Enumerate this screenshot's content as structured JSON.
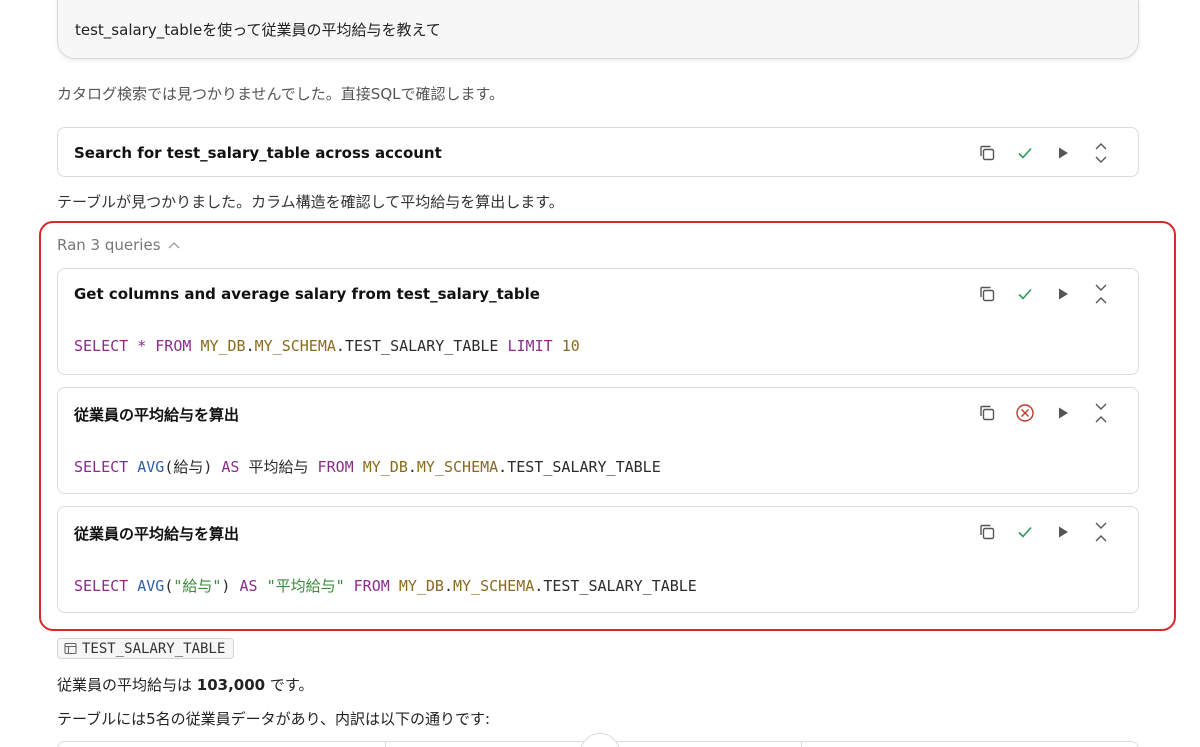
{
  "prompt": {
    "text": "test_salary_tableを使って従業員の平均給与を教えて"
  },
  "messages": {
    "catalog_note": "カタログ検索では見つかりませんでした。直接SQLで確認します。",
    "found_note": "テーブルが見つかりました。カラム構造を確認して平均給与を算出します。",
    "result_prefix": "従業員の平均給与は ",
    "result_value": "103,000",
    "result_suffix": " です。",
    "breakdown_note": "テーブルには5名の従業員データがあり、内訳は以下の通りです:"
  },
  "search_card": {
    "title": "Search for test_salary_table across account"
  },
  "query_group": {
    "label": "Ran 3 queries"
  },
  "queries": [
    {
      "title": "Get columns and average salary from test_salary_table",
      "status": "success",
      "code": {
        "kw1": "SELECT",
        "op": " * ",
        "kw2": "FROM",
        "db": "MY_DB",
        "dot1": ".",
        "schema": "MY_SCHEMA",
        "dot2": ".",
        "table": "TEST_SALARY_TABLE",
        "kw3": "LIMIT",
        "num": "10"
      }
    },
    {
      "title": "従業員の平均給与を算出",
      "status": "error",
      "code": {
        "kw1": "SELECT",
        "fn": "AVG",
        "args": "(給与)",
        "kw2": "AS",
        "alias": "平均給与",
        "kw3": "FROM",
        "db": "MY_DB",
        "dot1": ".",
        "schema": "MY_SCHEMA",
        "dot2": ".",
        "table": "TEST_SALARY_TABLE"
      }
    },
    {
      "title": "従業員の平均給与を算出",
      "status": "success",
      "code": {
        "kw1": "SELECT",
        "fn": "AVG",
        "open": "(",
        "arg": "\"給与\"",
        "close": ")",
        "kw2": "AS",
        "alias": "\"平均給与\"",
        "kw3": "FROM",
        "db": "MY_DB",
        "dot1": ".",
        "schema": "MY_SCHEMA",
        "dot2": ".",
        "table": "TEST_SALARY_TABLE"
      }
    }
  ],
  "table_chip": {
    "label": "TEST_SALARY_TABLE"
  },
  "icons": {
    "copy": "copy-icon",
    "check": "check-icon",
    "error": "error-circle-icon",
    "run": "play-icon",
    "expand": "expand-icon",
    "collapse": "collapse-icon",
    "chevron": "chevron-up-icon",
    "table": "table-icon"
  },
  "colors": {
    "highlight": "#d42a2a",
    "check": "#2e9a5a",
    "error": "#c0392b",
    "keyword": "#8a2d8a",
    "identifier": "#8a6a1e",
    "function": "#2d5fa8",
    "string": "#3a8a3a"
  }
}
